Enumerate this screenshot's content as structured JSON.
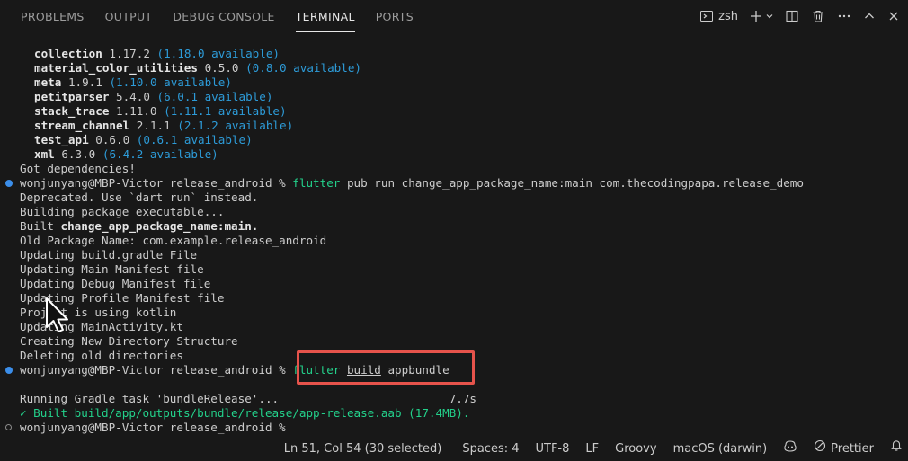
{
  "panel": {
    "tabs": [
      {
        "label": "PROBLEMS"
      },
      {
        "label": "OUTPUT"
      },
      {
        "label": "DEBUG CONSOLE"
      },
      {
        "label": "TERMINAL",
        "active": true
      },
      {
        "label": "PORTS"
      }
    ],
    "shell": "zsh"
  },
  "terminal": {
    "deps": [
      {
        "name": "collection",
        "version": "1.17.2",
        "available": "(1.18.0 available)"
      },
      {
        "name": "material_color_utilities",
        "version": "0.5.0",
        "available": "(0.8.0 available)"
      },
      {
        "name": "meta",
        "version": "1.9.1",
        "available": "(1.10.0 available)"
      },
      {
        "name": "petitparser",
        "version": "5.4.0",
        "available": "(6.0.1 available)"
      },
      {
        "name": "stack_trace",
        "version": "1.11.0",
        "available": "(1.11.1 available)"
      },
      {
        "name": "stream_channel",
        "version": "2.1.1",
        "available": "(2.1.2 available)"
      },
      {
        "name": "test_api",
        "version": "0.6.0",
        "available": "(0.6.1 available)"
      },
      {
        "name": "xml",
        "version": "6.3.0",
        "available": "(6.4.2 available)"
      }
    ],
    "got_deps": "Got dependencies!",
    "prompt": "wonjunyang@MBP-Victor release_android % ",
    "cmd1_flutter": "flutter",
    "cmd1_rest": " pub run change_app_package_name:main com.thecodingpapa.release_demo",
    "out1": "Deprecated. Use `dart run` instead.",
    "out2": "Building package executable...",
    "out3_prefix": "Built ",
    "out3_bold": "change_app_package_name:main.",
    "out4": "Old Package Name: com.example.release_android",
    "out5": "Updating build.gradle File",
    "out6": "Updating Main Manifest file",
    "out7": "Updating Debug Manifest file",
    "out8": "Updating Profile Manifest file",
    "out9": "Project is using kotlin",
    "out10": "Updating MainActivity.kt",
    "out11": "Creating New Directory Structure",
    "out12": "Deleting old directories",
    "cmd2_flutter": "flutter",
    "cmd2_build": "build",
    "cmd2_rest": " appbundle",
    "gradle": "Running Gradle task 'bundleRelease'...                         7.7s",
    "built": "✓ Built build/app/outputs/bundle/release/app-release.aab (17.4MB)."
  },
  "statusbar": {
    "position": "Ln 51, Col 54 (30 selected)",
    "spaces": "Spaces: 4",
    "encoding": "UTF-8",
    "eol": "LF",
    "language": "Groovy",
    "platform": "macOS (darwin)",
    "prettier": "Prettier"
  },
  "colors": {
    "background": "#181818",
    "blue_text": "#2d9bd8",
    "green_text": "#23d18b",
    "highlight_box": "#e5534b"
  }
}
